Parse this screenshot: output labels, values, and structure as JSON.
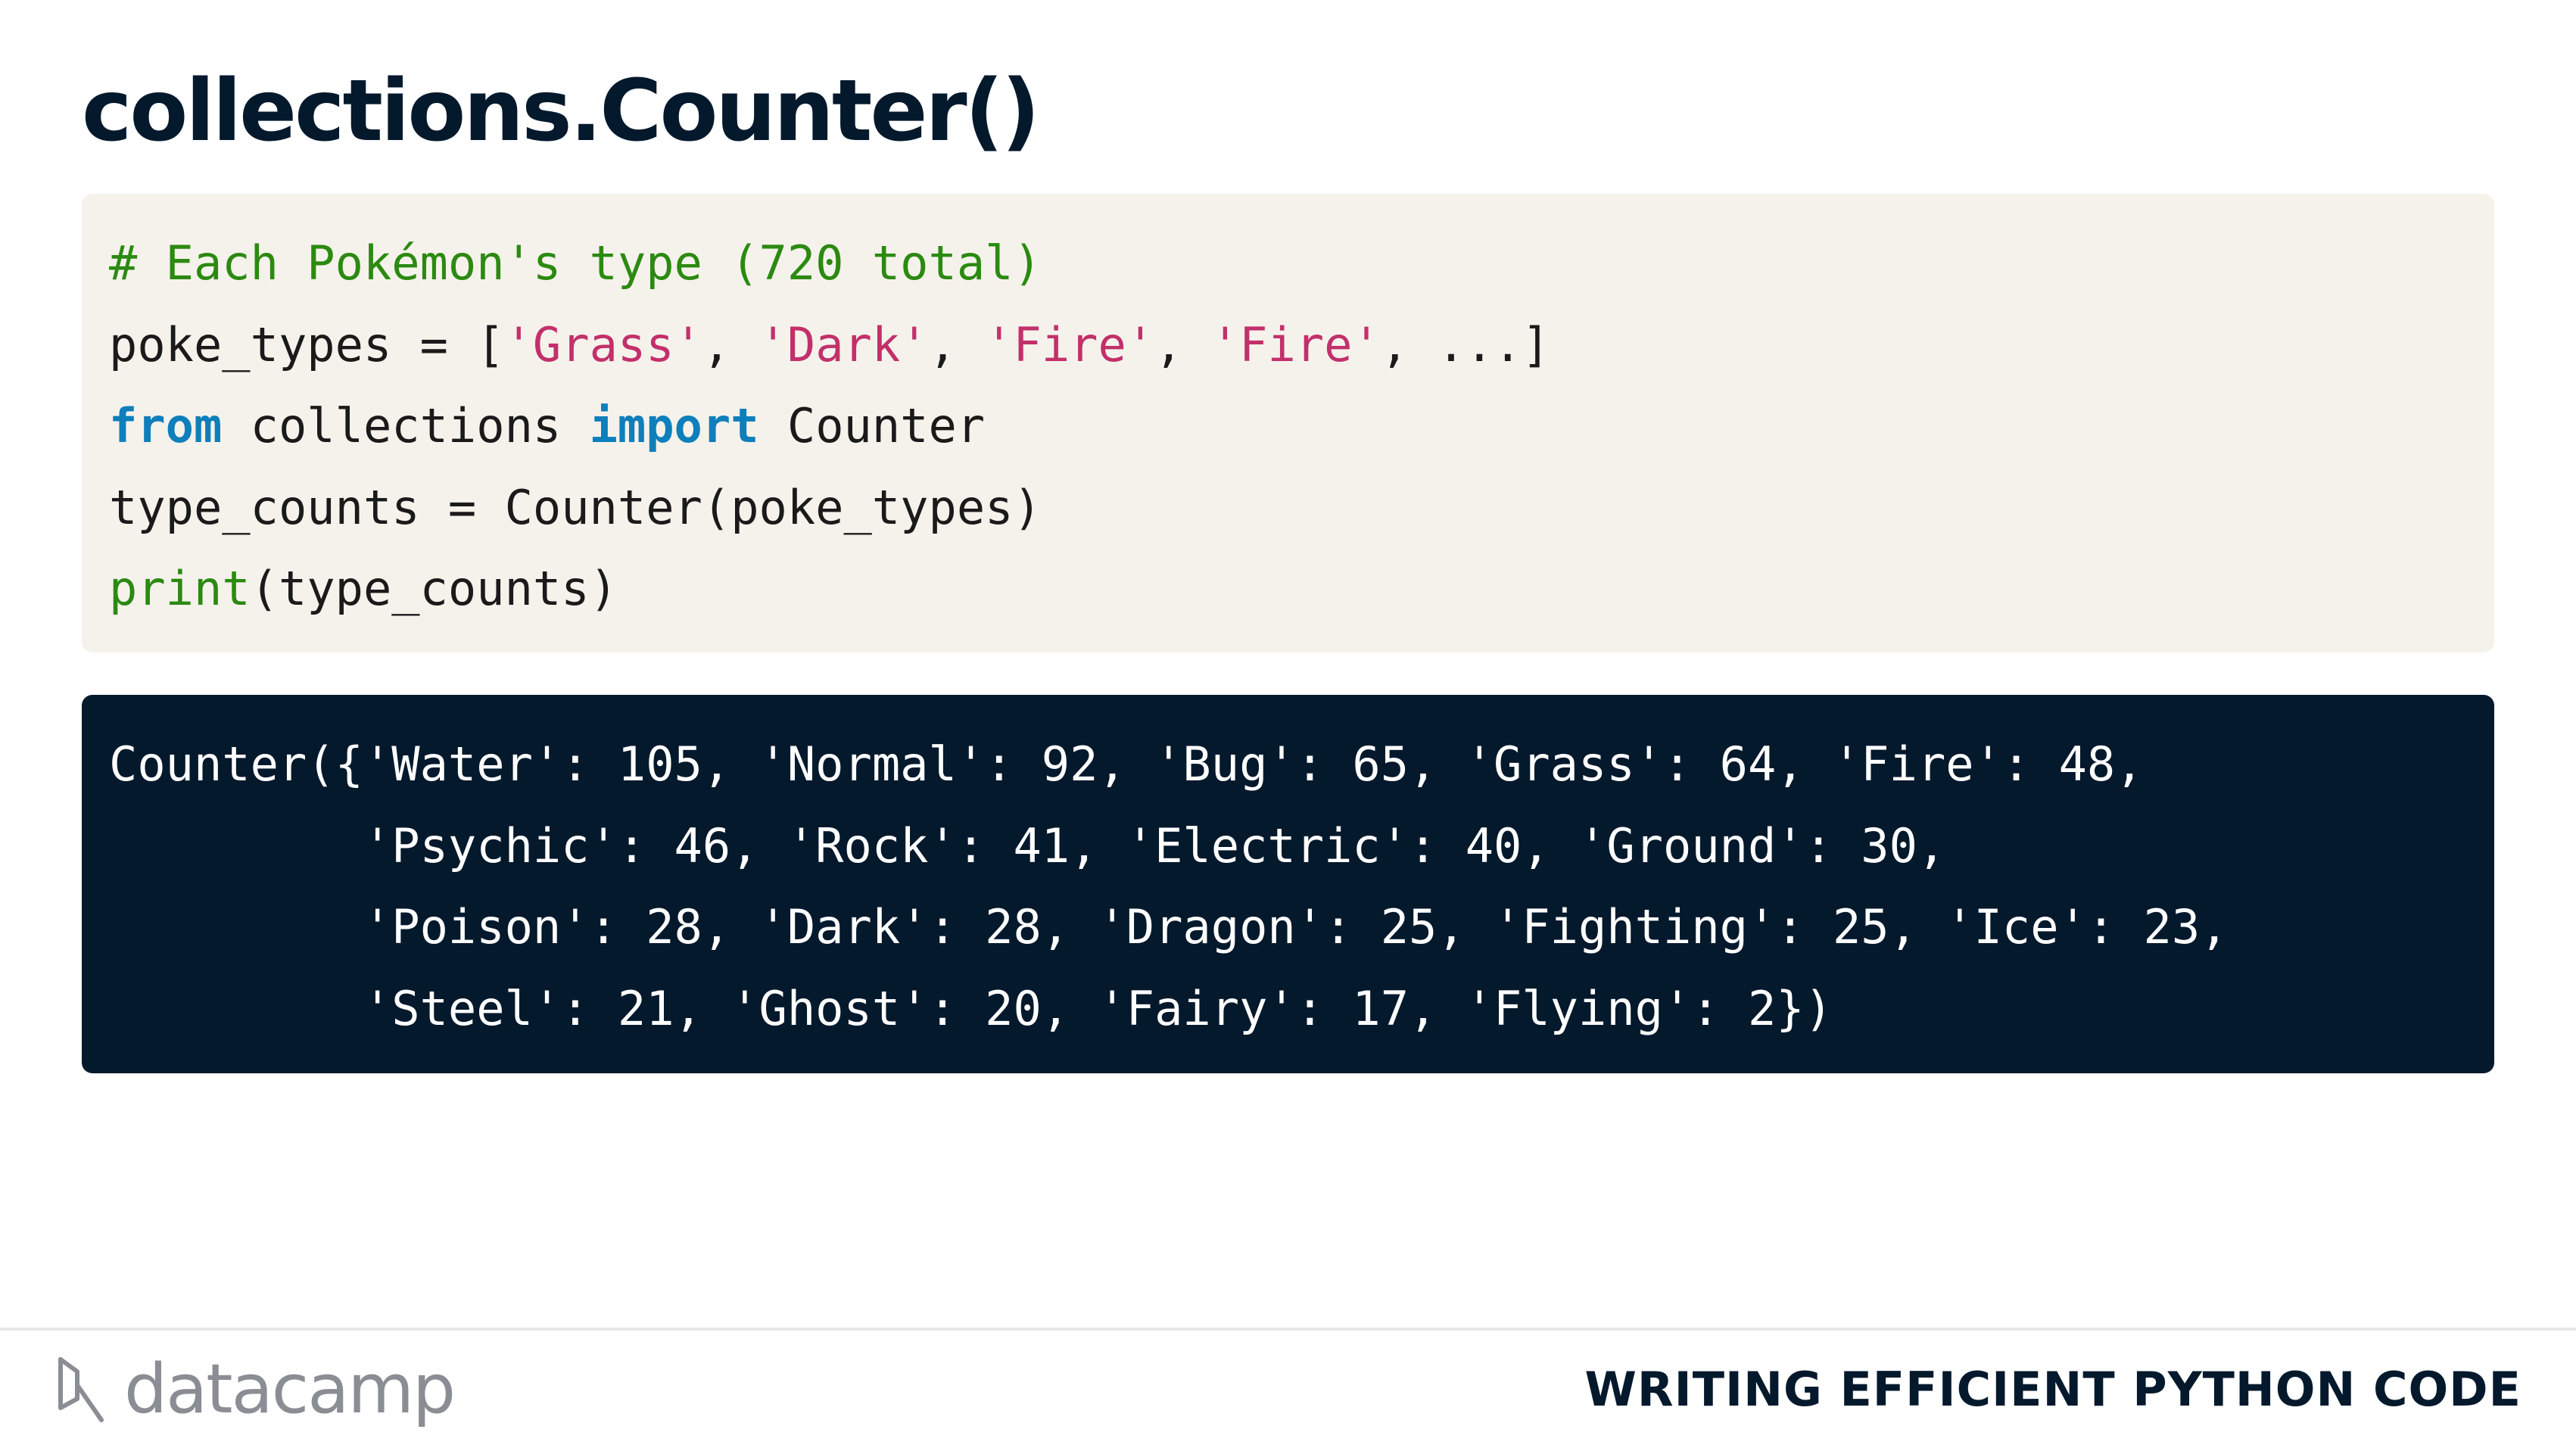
{
  "slide": {
    "title": "collections.Counter()"
  },
  "code": {
    "line1_comment": "# Each Pokémon's type (720 total)",
    "line2_pre": "poke_types = [",
    "line2_str1": "'Grass'",
    "line2_sep1": ", ",
    "line2_str2": "'Dark'",
    "line2_sep2": ", ",
    "line2_str3": "'Fire'",
    "line2_sep3": ", ",
    "line2_str4": "'Fire'",
    "line2_post": ", ...]",
    "line3_kw1": "from",
    "line3_mid": " collections ",
    "line3_kw2": "import",
    "line3_post": " Counter",
    "line4": "type_counts = Counter(poke_types)",
    "line5_builtin": "print",
    "line5_post": "(type_counts)"
  },
  "output": {
    "lines": [
      "Counter({'Water': 105, 'Normal': 92, 'Bug': 65, 'Grass': 64, 'Fire': 48,",
      "         'Psychic': 46, 'Rock': 41, 'Electric': 40, 'Ground': 30,",
      "         'Poison': 28, 'Dark': 28, 'Dragon': 25, 'Fighting': 25, 'Ice': 23,",
      "         'Steel': 21, 'Ghost': 20, 'Fairy': 17, 'Flying': 2})"
    ]
  },
  "footer": {
    "brand": "datacamp",
    "brand_icon": "datacamp-logo-icon",
    "course": "WRITING EFFICIENT PYTHON CODE"
  },
  "colors": {
    "navy": "#05192d",
    "code_bg": "#f5f2ec",
    "comment": "#2b8a10",
    "string": "#c2306a",
    "keyword": "#0e7fba"
  }
}
